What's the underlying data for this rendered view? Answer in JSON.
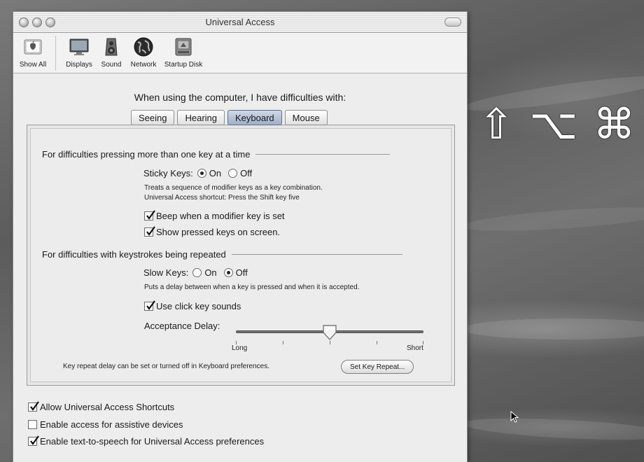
{
  "window": {
    "title": "Universal Access"
  },
  "toolbar": {
    "items": [
      {
        "label": "Show All",
        "icon": "apple-icon"
      },
      {
        "label": "Displays",
        "icon": "display-icon"
      },
      {
        "label": "Sound",
        "icon": "speaker-icon"
      },
      {
        "label": "Network",
        "icon": "globe-icon"
      },
      {
        "label": "Startup Disk",
        "icon": "disk-icon"
      }
    ]
  },
  "question": "When using the computer, I have difficulties with:",
  "tabs": [
    {
      "label": "Seeing",
      "active": false
    },
    {
      "label": "Hearing",
      "active": false
    },
    {
      "label": "Keyboard",
      "active": true
    },
    {
      "label": "Mouse",
      "active": false
    }
  ],
  "sticky": {
    "heading": "For difficulties pressing more than one key at a time",
    "label": "Sticky Keys:",
    "on_label": "On",
    "off_label": "Off",
    "selected": "On",
    "desc1": "Treats a sequence of modifier keys as a key combination.",
    "desc2": "Universal Access shortcut:  Press the Shift key five",
    "beep_label": "Beep when a modifier key is set",
    "beep_checked": true,
    "show_label": "Show pressed keys on screen.",
    "show_checked": true
  },
  "slow": {
    "heading": "For difficulties with keystrokes being repeated",
    "label": "Slow Keys:",
    "on_label": "On",
    "off_label": "Off",
    "selected": "Off",
    "desc": "Puts a delay between when a key is pressed and when it is accepted.",
    "click_label": "Use click key sounds",
    "click_checked": true,
    "delay_label": "Acceptance Delay:",
    "delay_value": 0.5,
    "long_label": "Long",
    "short_label": "Short"
  },
  "repeat": {
    "note": "Key repeat delay can be set or turned off in Keyboard preferences.",
    "button_label": "Set Key Repeat..."
  },
  "bottom": {
    "allow_shortcuts": {
      "label": "Allow Universal Access Shortcuts",
      "checked": true
    },
    "assistive": {
      "label": "Enable access for assistive devices",
      "checked": false
    },
    "tts": {
      "label": "Enable text-to-speech for Universal Access preferences",
      "checked": true
    }
  },
  "desktop": {
    "modifier_glyphs": [
      "⇧",
      "⌥",
      "⌘"
    ]
  }
}
